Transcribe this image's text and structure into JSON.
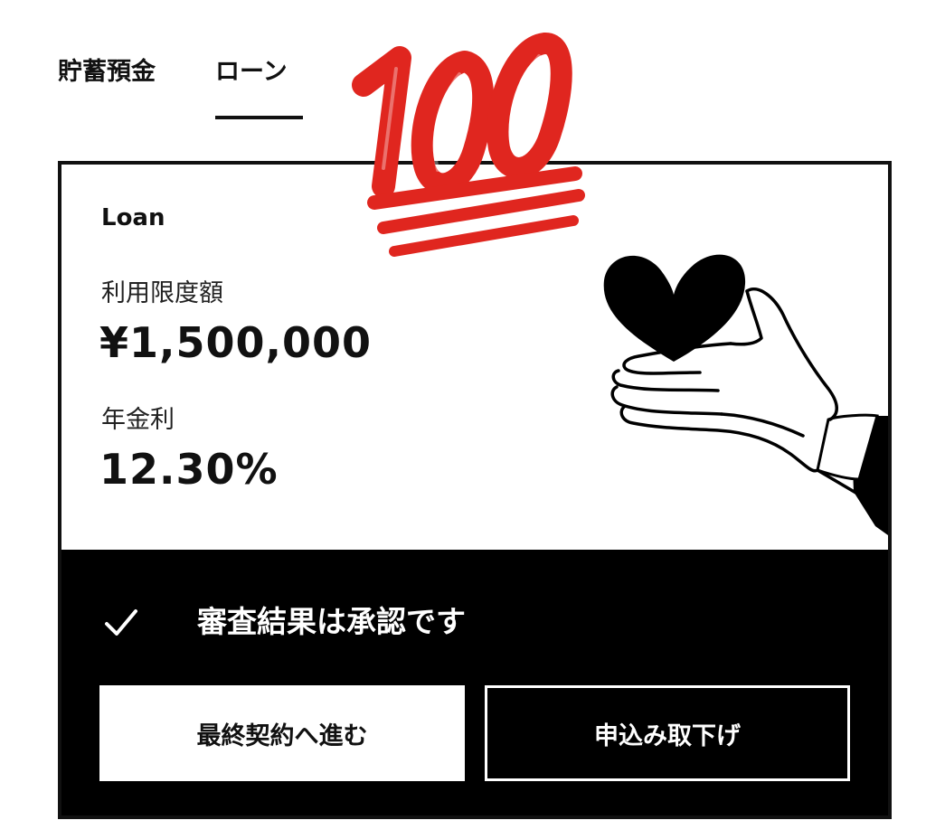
{
  "tabs": [
    {
      "label": "貯蓄預金",
      "active": false
    },
    {
      "label": "ローン",
      "active": true
    }
  ],
  "badge": {
    "icon": "hundred-points-emoji",
    "color": "#e0261f"
  },
  "card": {
    "label": "Loan",
    "limit_label": "利用限度額",
    "limit_value": "¥1,500,000",
    "rate_label": "年金利",
    "rate_value": "12.30%",
    "illustration": "hand-holding-heart-icon"
  },
  "status": {
    "icon": "check-icon",
    "text": "審査結果は承認です"
  },
  "actions": {
    "contract_label": "最終契約へ進む",
    "withdraw_label": "申込み取下げ"
  },
  "colors": {
    "primary": "#000000",
    "background": "#ffffff",
    "accent": "#e0261f"
  }
}
